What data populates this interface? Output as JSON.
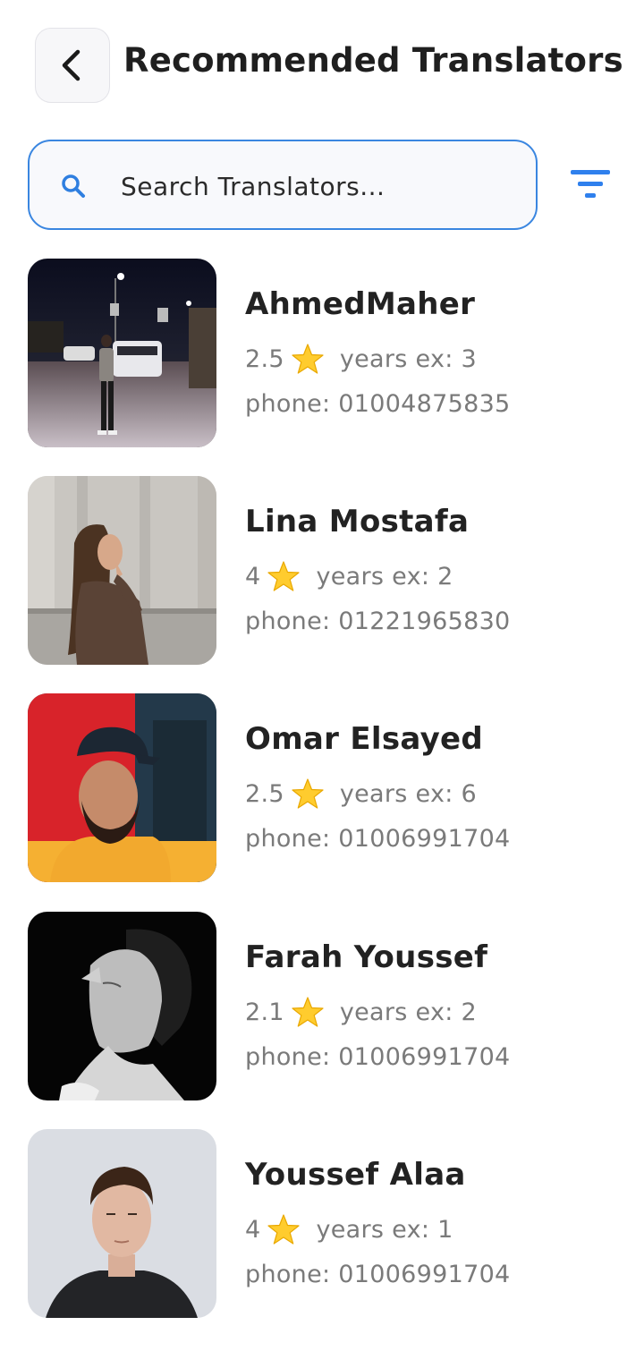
{
  "header": {
    "title": "Recommended Translators",
    "back_icon": "chevron-left-icon"
  },
  "search": {
    "placeholder": "Search Translators...",
    "value": "",
    "icon": "search-icon",
    "accent_color": "#3a86e0"
  },
  "filter": {
    "icon": "filter-icon",
    "color": "#2f80ed"
  },
  "translators": [
    {
      "name": "AhmedMaher",
      "rating": "2.5",
      "years_label": "years ex: 3",
      "phone_label": "phone: 01004875835"
    },
    {
      "name": "Lina Mostafa",
      "rating": "4",
      "years_label": "years ex: 2",
      "phone_label": "phone: 01221965830"
    },
    {
      "name": "Omar Elsayed",
      "rating": "2.5",
      "years_label": "years ex: 6",
      "phone_label": "phone: 01006991704"
    },
    {
      "name": "Farah Youssef",
      "rating": "2.1",
      "years_label": "years ex: 2",
      "phone_label": "phone: 01006991704"
    },
    {
      "name": "Youssef Alaa",
      "rating": "4",
      "years_label": "years ex: 1",
      "phone_label": "phone: 01006991704"
    }
  ]
}
